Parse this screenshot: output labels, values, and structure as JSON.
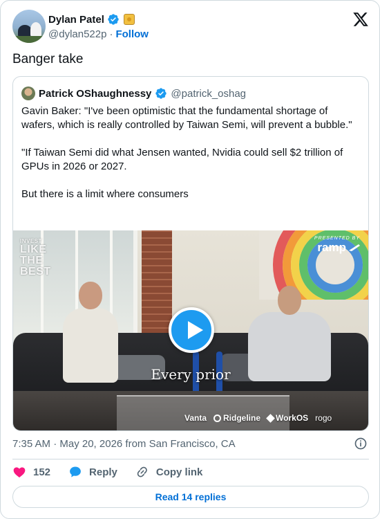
{
  "author": {
    "name": "Dylan Patel",
    "handle": "@dylan522p",
    "separator": "·",
    "follow_label": "Follow"
  },
  "tweet": {
    "text": "Banger take",
    "timestamp": "7:35 AM · May 20, 2026 from San Francisco, CA"
  },
  "quote": {
    "name": "Patrick OShaughnessy",
    "handle": "@patrick_oshag",
    "paragraphs": [
      "Gavin Baker: \"I've been optimistic that the fundamental shortage of wafers, which is really controlled by Taiwan Semi, will prevent a bubble.\"",
      "\"If Taiwan Semi did what Jensen wanted, Nvidia could sell $2 trillion of GPUs in 2026 or 2027.",
      "But there is a limit where consumers"
    ],
    "video": {
      "logo_small": "INVEST",
      "logo_line1": "LIKE THE",
      "logo_line2": "BEST",
      "presented_by": "PRESENTED BY",
      "sponsor_top": "ramp",
      "caption": "Every prior",
      "sponsors": [
        "Vanta",
        "Ridgeline",
        "WorkOS",
        "rogo"
      ]
    }
  },
  "actions": {
    "likes_count": "152",
    "reply_label": "Reply",
    "copy_link_label": "Copy link",
    "read_replies_label": "Read 14 replies"
  },
  "colors": {
    "accent": "#1d9bf0",
    "link": "#006fd6",
    "like": "#f91880",
    "muted": "#536471",
    "border": "#cfd9de"
  },
  "icons": [
    "verified-badge-icon",
    "x-logo-icon",
    "play-icon",
    "heart-icon",
    "reply-bubble-icon",
    "link-icon",
    "info-icon",
    "ramp-plane-icon"
  ]
}
